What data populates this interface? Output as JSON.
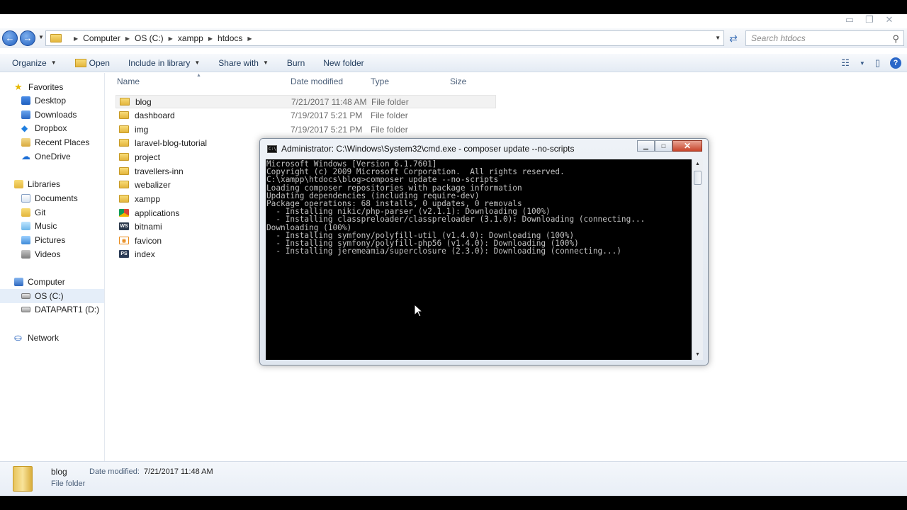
{
  "window": {
    "caption_min": "▭",
    "caption_max": "❐",
    "caption_close": "✕"
  },
  "address": {
    "crumbs": [
      "Computer",
      "OS (C:)",
      "xampp",
      "htdocs"
    ],
    "search_placeholder": "Search htdocs"
  },
  "toolbar": {
    "organize": "Organize",
    "open": "Open",
    "include_in_library": "Include in library",
    "share_with": "Share with",
    "burn": "Burn",
    "new_folder": "New folder"
  },
  "nav": {
    "favorites": "Favorites",
    "desktop": "Desktop",
    "downloads": "Downloads",
    "dropbox": "Dropbox",
    "recent_places": "Recent Places",
    "onedrive": "OneDrive",
    "libraries": "Libraries",
    "documents": "Documents",
    "git": "Git",
    "music": "Music",
    "pictures": "Pictures",
    "videos": "Videos",
    "computer": "Computer",
    "os_c": "OS (C:)",
    "datapart1": "DATAPART1 (D:)",
    "network": "Network"
  },
  "columns": {
    "name": "Name",
    "date_modified": "Date modified",
    "type": "Type",
    "size": "Size"
  },
  "files": [
    {
      "name": "blog",
      "date": "7/21/2017 11:48 AM",
      "type": "File folder"
    },
    {
      "name": "dashboard",
      "date": "7/19/2017 5:21 PM",
      "type": "File folder"
    },
    {
      "name": "img",
      "date": "7/19/2017 5:21 PM",
      "type": "File folder"
    },
    {
      "name": "laravel-blog-tutorial"
    },
    {
      "name": "project"
    },
    {
      "name": "travellers-inn"
    },
    {
      "name": "webalizer"
    },
    {
      "name": "xampp"
    },
    {
      "name": "applications"
    },
    {
      "name": "bitnami"
    },
    {
      "name": "favicon"
    },
    {
      "name": "index"
    }
  ],
  "details": {
    "name": "blog",
    "kind": "File folder",
    "date_label": "Date modified:",
    "date_value": "7/21/2017 11:48 AM"
  },
  "cmd": {
    "title": "Administrator: C:\\Windows\\System32\\cmd.exe - composer  update --no-scripts",
    "lines": [
      "Microsoft Windows [Version 6.1.7601]",
      "Copyright (c) 2009 Microsoft Corporation.  All rights reserved.",
      "",
      "C:\\xampp\\htdocs\\blog>composer update --no-scripts",
      "Loading composer repositories with package information",
      "Updating dependencies (including require-dev)",
      "Package operations: 68 installs, 0 updates, 0 removals",
      "  - Installing nikic/php-parser (v2.1.1): Downloading (100%)",
      "  - Installing classpreloader/classpreloader (3.1.0): Downloading (connecting...",
      "Downloading (100%)",
      "  - Installing symfony/polyfill-util (v1.4.0): Downloading (100%)",
      "  - Installing symfony/polyfill-php56 (v1.4.0): Downloading (100%)",
      "  - Installing jeremeamia/superclosure (2.3.0): Downloading (connecting...)"
    ]
  }
}
